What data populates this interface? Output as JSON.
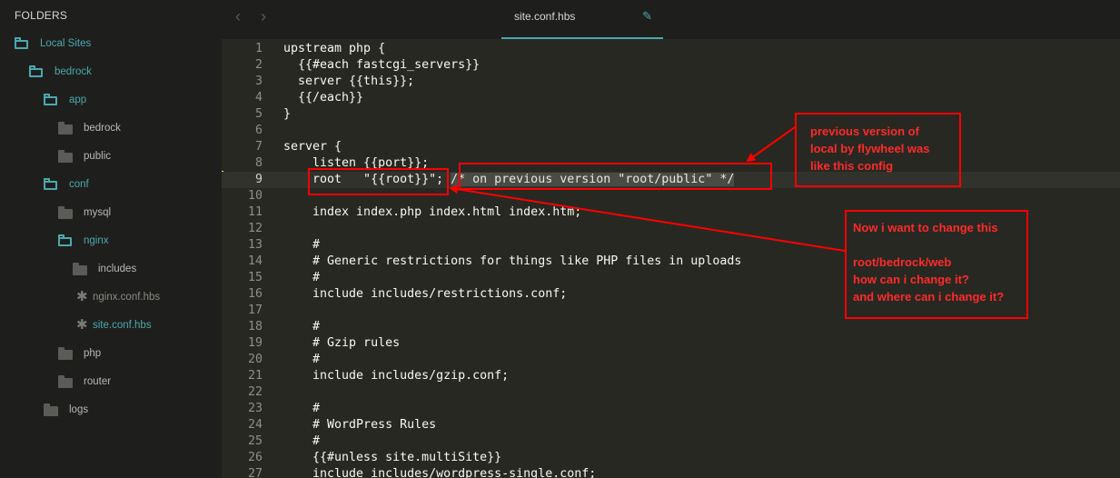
{
  "sidebar": {
    "title": "FOLDERS",
    "items": [
      {
        "label": "Local Sites",
        "kind": "folder-open"
      },
      {
        "label": "bedrock",
        "kind": "folder-open"
      },
      {
        "label": "app",
        "kind": "folder-open"
      },
      {
        "label": "bedrock",
        "kind": "folder-closed"
      },
      {
        "label": "public",
        "kind": "folder-closed"
      },
      {
        "label": "conf",
        "kind": "folder-open"
      },
      {
        "label": "mysql",
        "kind": "folder-closed"
      },
      {
        "label": "nginx",
        "kind": "folder-open"
      },
      {
        "label": "includes",
        "kind": "folder-closed"
      },
      {
        "label": "nginx.conf.hbs",
        "kind": "file"
      },
      {
        "label": "site.conf.hbs",
        "kind": "file"
      },
      {
        "label": "php",
        "kind": "folder-closed"
      },
      {
        "label": "router",
        "kind": "folder-closed"
      },
      {
        "label": "logs",
        "kind": "folder-closed"
      }
    ]
  },
  "tabbar": {
    "back_icon": "chevron-left-icon",
    "forward_icon": "chevron-right-icon",
    "tab_label": "site.conf.hbs",
    "edit_icon": "pencil-icon"
  },
  "editor": {
    "current_line": 9,
    "lines": [
      {
        "n": "1",
        "text": "upstream php {"
      },
      {
        "n": "2",
        "text": "  {{#each fastcgi_servers}}"
      },
      {
        "n": "3",
        "text": "  server {{this}};"
      },
      {
        "n": "4",
        "text": "  {{/each}}"
      },
      {
        "n": "5",
        "text": "}"
      },
      {
        "n": "6",
        "text": ""
      },
      {
        "n": "7",
        "text": "server {"
      },
      {
        "n": "8",
        "text": "    listen {{port}};"
      },
      {
        "n": "9",
        "text": "    root   \"{{root}}\"; ",
        "comment": "/* on previous version \"root/public\" */"
      },
      {
        "n": "10",
        "text": ""
      },
      {
        "n": "11",
        "text": "    index index.php index.html index.htm;"
      },
      {
        "n": "12",
        "text": ""
      },
      {
        "n": "13",
        "text": "    #"
      },
      {
        "n": "14",
        "text": "    # Generic restrictions for things like PHP files in uploads"
      },
      {
        "n": "15",
        "text": "    #"
      },
      {
        "n": "16",
        "text": "    include includes/restrictions.conf;"
      },
      {
        "n": "17",
        "text": ""
      },
      {
        "n": "18",
        "text": "    #"
      },
      {
        "n": "19",
        "text": "    # Gzip rules"
      },
      {
        "n": "20",
        "text": "    #"
      },
      {
        "n": "21",
        "text": "    include includes/gzip.conf;"
      },
      {
        "n": "22",
        "text": ""
      },
      {
        "n": "23",
        "text": "    #"
      },
      {
        "n": "24",
        "text": "    # WordPress Rules"
      },
      {
        "n": "25",
        "text": "    #"
      },
      {
        "n": "26",
        "text": "    {{#unless site.multiSite}}"
      },
      {
        "n": "27",
        "text": "    include includes/wordpress-single.conf;"
      }
    ]
  },
  "annotations": {
    "note1": "previous version of\nlocal by flywheel was\nlike this config",
    "note2": "Now i want to change this\n\nroot/bedrock/web\nhow can i change it?\nand where can i change it?",
    "color": "#ff0000"
  }
}
